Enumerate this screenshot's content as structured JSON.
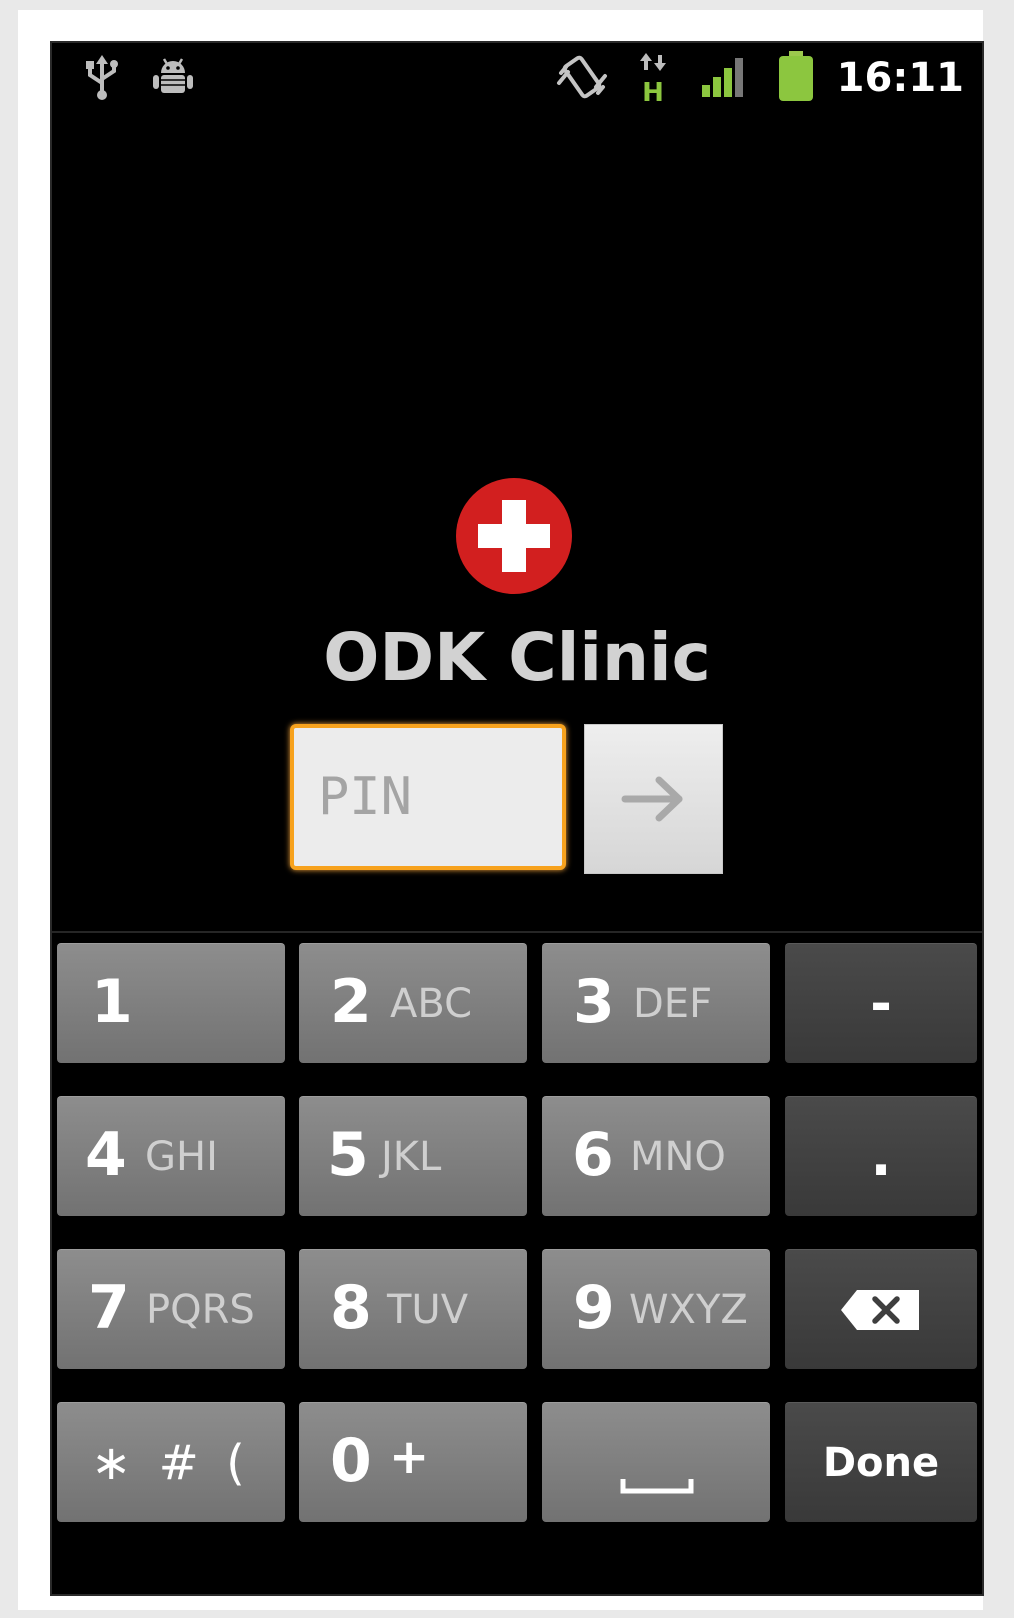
{
  "status_bar": {
    "time": "16:11",
    "icons": [
      "usb-icon",
      "android-debug-icon",
      "vibrate-icon",
      "hspa-data-icon",
      "signal-strength-icon",
      "battery-icon"
    ],
    "data_label": "H",
    "accent_color": "#8cc63f"
  },
  "app": {
    "title": "ODK Clinic",
    "logo_icon": "red-cross-icon",
    "logo_color": "#d21f1f",
    "pin_placeholder": "PIN",
    "go_icon": "arrow-right-icon",
    "focus_color": "#f7a21d"
  },
  "keyboard": {
    "rows": [
      [
        {
          "num": "1",
          "letters": ""
        },
        {
          "num": "2",
          "letters": "ABC"
        },
        {
          "num": "3",
          "letters": "DEF"
        },
        {
          "label": "-"
        }
      ],
      [
        {
          "num": "4",
          "letters": "GHI"
        },
        {
          "num": "5",
          "letters": "JKL"
        },
        {
          "num": "6",
          "letters": "MNO"
        },
        {
          "label": "."
        }
      ],
      [
        {
          "num": "7",
          "letters": "PQRS"
        },
        {
          "num": "8",
          "letters": "TUV"
        },
        {
          "num": "9",
          "letters": "WXYZ"
        },
        {
          "icon": "backspace-icon"
        }
      ],
      [
        {
          "label": "∗ # ("
        },
        {
          "num": "0",
          "letters": "+"
        },
        {
          "icon": "space-icon"
        },
        {
          "label": "Done"
        }
      ]
    ]
  }
}
